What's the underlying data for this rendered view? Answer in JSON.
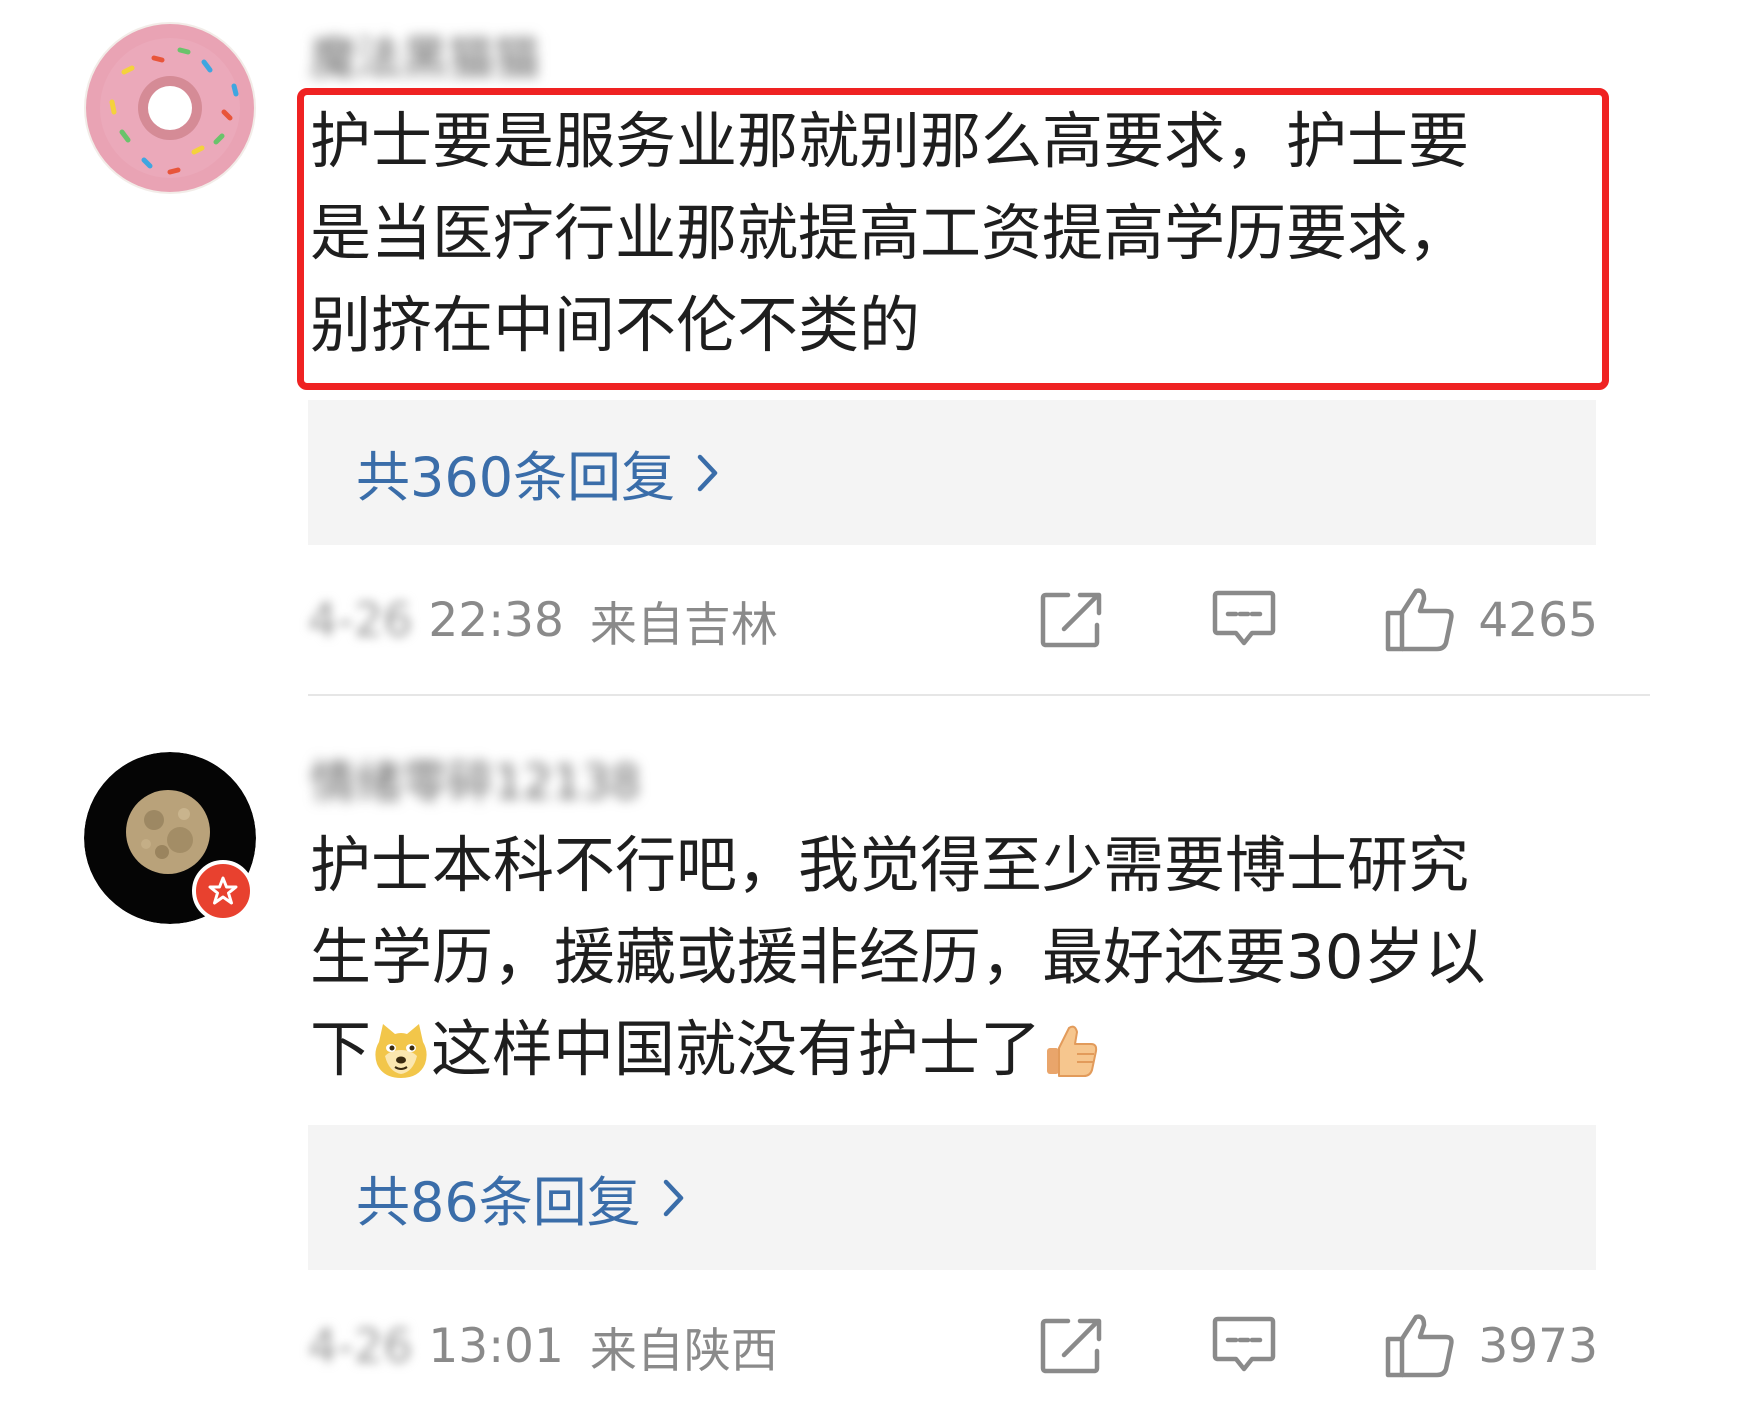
{
  "comments": [
    {
      "username": "魔法黑猫猫",
      "text": "护士要是服务业那就别那么高要求，护士要是当医疗行业那就提高工资提高学历要求，别挤在中间不伦不类的",
      "lines": [
        "护士要是服务业那就别那么高要求，护士要",
        "是当医疗行业那就提高工资提高学历要求，",
        "别挤在中间不伦不类的"
      ],
      "replies_label": "共360条回复",
      "date": "4-26",
      "time": "22:38",
      "location": "来自吉林",
      "likes": "4265",
      "highlight_color": "#ef2222"
    },
    {
      "username": "情绪零碎12138",
      "lines": [
        "护士本科不行吧，我觉得至少需要博士研究",
        "生学历，援藏或援非经历，最好还要30岁以",
        "下",
        "这样中国就没有护士了"
      ],
      "emojis": [
        "doge-emoji",
        "thumbs-up-emoji"
      ],
      "replies_label": "共86条回复",
      "date": "4-26",
      "time": "13:01",
      "location": "来自陕西",
      "likes": "3973"
    }
  ],
  "colors": {
    "link": "#3a6da9",
    "meta": "#8a8a8a",
    "reply_bg": "#f4f4f4",
    "badge": "#e8412f"
  },
  "icons": [
    "share-icon",
    "comment-icon",
    "like-icon",
    "chevron-right-icon"
  ]
}
